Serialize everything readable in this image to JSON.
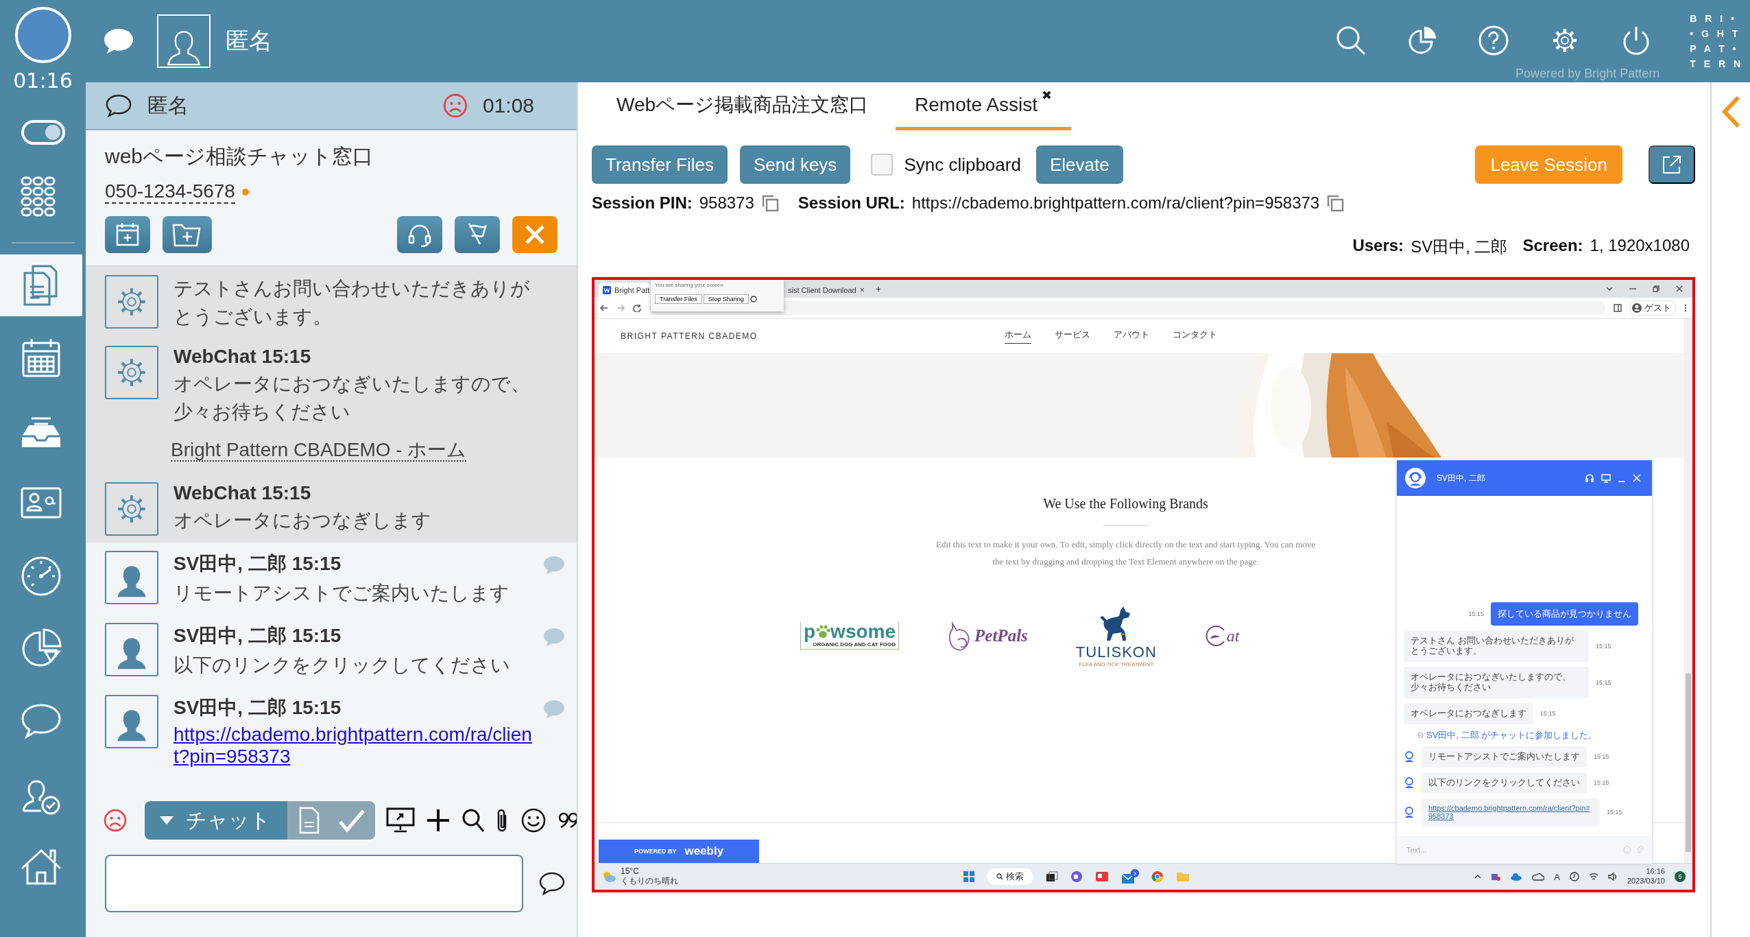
{
  "top_bar": {
    "contact_name": "匿名",
    "powered_by": "Powered by Bright Pattern",
    "logo_rows": [
      "B R I •",
      "• G H T",
      "P A T •",
      "T E R N"
    ]
  },
  "sidebar": {
    "timer": "01:16",
    "status_toggle": {
      "on": true
    },
    "items": [
      {
        "kind": "dialpad",
        "selected": false
      },
      {
        "kind": "documents",
        "selected": true
      },
      {
        "kind": "calendar",
        "selected": false
      },
      {
        "kind": "inbox",
        "selected": false
      },
      {
        "kind": "contact-card",
        "selected": false
      },
      {
        "kind": "gauge",
        "selected": false
      },
      {
        "kind": "pie",
        "selected": false
      },
      {
        "kind": "chat",
        "selected": false
      },
      {
        "kind": "user-check",
        "selected": false
      },
      {
        "kind": "home",
        "selected": false
      }
    ]
  },
  "chat_panel": {
    "title": "匿名",
    "unhappy": true,
    "timer": "01:08",
    "service": "webページ相談チャット窓口",
    "phone": "050-1234-5678",
    "messages": [
      {
        "kind": "bot",
        "text": "テストさんお問い合わせいただきありがとうございます。"
      },
      {
        "kind": "bot",
        "sender": "WebChat",
        "time": "15:15",
        "text": "オペレータにおつなぎいたしますので、少々お待ちください"
      },
      {
        "kind": "link",
        "text": "Bright Pattern CBADEMO - ホーム"
      },
      {
        "kind": "bot",
        "sender": "WebChat",
        "time": "15:15",
        "text": "オペレータにおつなぎします"
      },
      {
        "kind": "agent",
        "sender": "SV田中, 二郎",
        "time": "15:15",
        "text": "リモートアシストでご案内いたします"
      },
      {
        "kind": "agent",
        "sender": "SV田中, 二郎",
        "time": "15:15",
        "text": "以下のリンクをクリックしてください"
      },
      {
        "kind": "agent_link",
        "sender": "SV田中, 二郎",
        "time": "15:15",
        "text": "https://cbademo.brightpattern.com/ra/client?pin=958373"
      }
    ],
    "composer": {
      "unhappy": true,
      "mode": "チャット"
    }
  },
  "workspace": {
    "tabs": [
      {
        "label": "Webページ掲載商品注文窓口",
        "selected": false
      },
      {
        "label": "Remote Assist",
        "selected": true,
        "close": "✖"
      }
    ],
    "actions": [
      {
        "kind": "button",
        "label": "Transfer Files"
      },
      {
        "kind": "button",
        "label": "Send keys"
      },
      {
        "kind": "checkbox",
        "label": "Sync clipboard",
        "checked": false
      },
      {
        "kind": "button",
        "label": "Elevate"
      }
    ],
    "leave_button": "Leave Session",
    "session": [
      {
        "label": "Session PIN:",
        "value": "958373"
      },
      {
        "label": "Session URL:",
        "value": "https://cbademo.brightpattern.com/ra/client?pin=958373"
      }
    ],
    "info": [
      {
        "label": "Users:",
        "value": "SV田中, 二郎"
      },
      {
        "label": "Screen:",
        "value": "1, 1920x1080"
      }
    ],
    "remote_screen": {
      "browser_tabs": [
        {
          "label": "Bright Patt",
          "selected": true
        },
        {
          "label": "sist Client Download",
          "selected": false,
          "close": "×"
        }
      ],
      "new_tab": "+",
      "share_bar": {
        "message": "You are sharing your screen",
        "buttons": [
          "Transfer Files",
          "Stop Sharing"
        ]
      },
      "profile": "ゲスト",
      "site": {
        "brand": "BRIGHT PATTERN CBADEMO",
        "nav": [
          {
            "label": "ホーム",
            "selected": true
          },
          {
            "label": "サービス",
            "selected": false
          },
          {
            "label": "アバウト",
            "selected": false
          },
          {
            "label": "コンタクト",
            "selected": false
          }
        ],
        "heading": "We Use the Following Brands",
        "body": "Edit this text to make it your own. To edit, simply click directly on the text and start typing. You can move the text by dragging and dropping the Text Element anywhere on the page.",
        "brands": [
          {
            "kind": "pawsome",
            "name_start": "p",
            "name_end": "wsome",
            "tagline": "ORGANIC DOG AND CAT FOOD"
          },
          {
            "kind": "petpals",
            "name": "PetPals"
          },
          {
            "kind": "tuliskon",
            "name": "TULISKON",
            "tagline": "FLEA AND TICK TREATMENT"
          },
          {
            "kind": "cat",
            "name": "at"
          }
        ],
        "powered": {
          "prefix": "POWERED BY",
          "brand": "weebly"
        }
      },
      "chat_widget": {
        "agent": "SV田中, 二郎",
        "messages": [
          {
            "kind": "visitor",
            "text": "探している商品が見つかりません",
            "time": "15:15"
          },
          {
            "kind": "bot",
            "text": "テストさん お問い合わせいただきありがとうございます。",
            "time": "15:15"
          },
          {
            "kind": "bot",
            "text": "オペレータにおつなぎいたしますので、少々お待ちください",
            "time": "15:15"
          },
          {
            "kind": "bot",
            "text": "オペレータにおつなぎします",
            "time": "15:15"
          },
          {
            "kind": "notice",
            "text": "SV田中, 二郎 がチャットに参加しました。"
          },
          {
            "kind": "agent",
            "text": "リモートアシストでご案内いたします",
            "time": "15:15"
          },
          {
            "kind": "agent",
            "text": "以下のリンクをクリックしてください",
            "time": "15:15"
          },
          {
            "kind": "agent_link",
            "text": "https://cbademo.brightpattern.com/ra/client?pin=958373",
            "time": "15:15"
          }
        ],
        "placeholder": "Text..."
      },
      "taskbar": {
        "temperature": "15°C",
        "weather": "くもりのち晴れ",
        "search": "検索",
        "mail_badge": "3",
        "tray_letter": "A",
        "time": "16:16",
        "date": "2023/03/10",
        "notifications": "5"
      }
    }
  }
}
